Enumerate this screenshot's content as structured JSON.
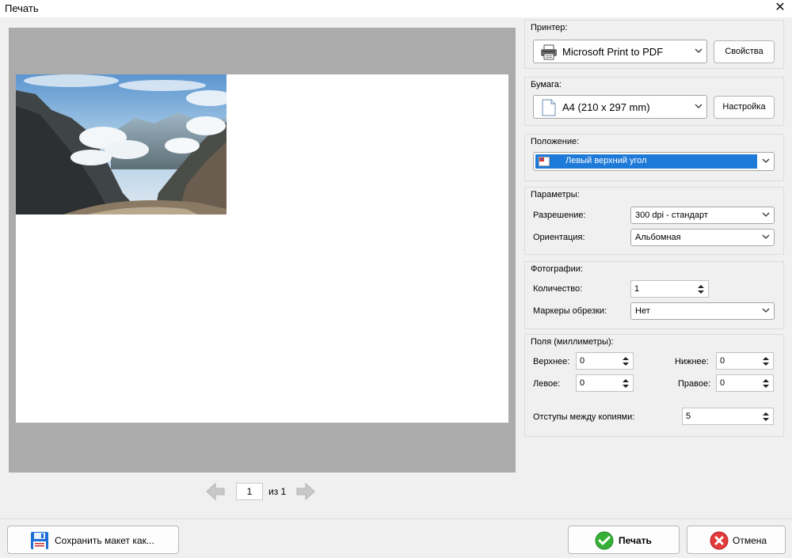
{
  "window": {
    "title": "Печать",
    "close_glyph": "✕"
  },
  "pager": {
    "page": "1",
    "of_text": "из 1"
  },
  "printer": {
    "label": "Принтер:",
    "value": "Microsoft Print to PDF",
    "properties_button": "Свойства"
  },
  "paper": {
    "label": "Бумага:",
    "value": "A4 (210 x 297 mm)",
    "settings_button": "Настройка"
  },
  "position": {
    "label": "Положение:",
    "value": "Левый верхний угол",
    "highlight_color": "#1e7ad8"
  },
  "params": {
    "label": "Параметры:",
    "resolution_label": "Разрешение:",
    "resolution_value": "300 dpi - стандарт",
    "orientation_label": "Ориентация:",
    "orientation_value": "Альбомная"
  },
  "photos": {
    "label": "Фотографии:",
    "quantity_label": "Количество:",
    "quantity_value": "1",
    "crop_marks_label": "Маркеры обрезки:",
    "crop_marks_value": "Нет"
  },
  "margins": {
    "label": "Поля (миллиметры):",
    "top_label": "Верхнее:",
    "top_value": "0",
    "bottom_label": "Нижнее:",
    "bottom_value": "0",
    "left_label": "Левое:",
    "left_value": "0",
    "right_label": "Правое:",
    "right_value": "0",
    "spacing_label": "Отступы между копиями:",
    "spacing_value": "5"
  },
  "footer": {
    "save_layout_button": "Сохранить макет как...",
    "print_button": "Печать",
    "cancel_button": "Отмена"
  },
  "icons": {
    "printer": "printer-icon",
    "paper": "document-icon",
    "position": "image-position-icon",
    "save": "floppy-disk-icon",
    "print": "green-check-icon",
    "cancel": "red-cancel-icon"
  }
}
